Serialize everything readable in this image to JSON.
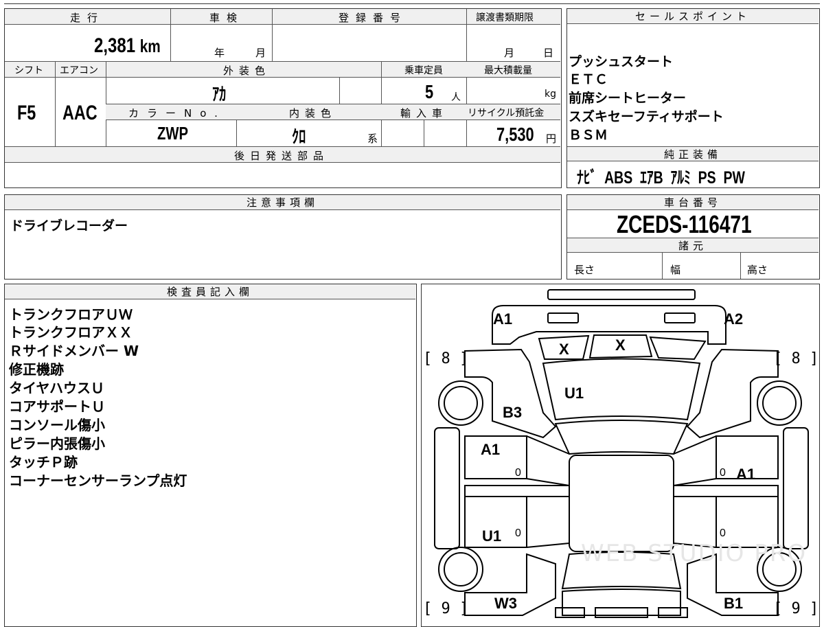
{
  "vehicle": {
    "headers": {
      "mileage": "走行",
      "inspection": "車検",
      "registration_no": "登録番号",
      "transfer_deadline": "譲渡書類期限",
      "shift": "シフト",
      "aircon": "エアコン",
      "exterior_color": "外装色",
      "capacity": "乗車定員",
      "max_load": "最大積載量",
      "color_no": "カラーNo.",
      "interior_color": "内装色",
      "import": "輸入車",
      "recycle_fee": "リサイクル預託金",
      "later_parts": "後日発送部品"
    },
    "mileage_value": "2,381",
    "mileage_unit": "km",
    "inspection_year_unit": "年",
    "inspection_month_unit": "月",
    "deadline_month_unit": "月",
    "deadline_day_unit": "日",
    "shift_value": "F5",
    "aircon_value": "AAC",
    "exterior_color_value": "ｱｶ",
    "capacity_value": "5",
    "capacity_unit": "人",
    "max_load_unit": "kg",
    "color_no_value": "ZWP",
    "interior_color_value": "ｸﾛ",
    "interior_color_unit": "系",
    "recycle_fee_value": "7,530",
    "recycle_fee_unit": "円"
  },
  "sales_points": {
    "header": "セールスポイント",
    "items": [
      "プッシュスタート",
      "ＥＴＣ",
      "前席シートヒーター",
      "スズキセーフティサポート",
      "ＢＳＭ"
    ]
  },
  "genuine_equipment": {
    "header": "純正装備",
    "value": "ﾅﾋﾞ  ABS  ｴｱB  ｱﾙﾐ  PS  PW"
  },
  "notes": {
    "header": "注意事項欄",
    "value": "ドライブレコーダー"
  },
  "chassis": {
    "header": "車台番号",
    "value": "ZCEDS-116471",
    "specs_header": "諸元",
    "length_label": "長さ",
    "width_label": "幅",
    "height_label": "高さ"
  },
  "inspector": {
    "header": "検査員記入欄",
    "lines": [
      "トランクフロアＵＷ",
      "トランクフロアＸＸ",
      "Ｒサイドメンバー W",
      "修正機跡",
      "タイヤハウスＵ",
      "コアサポートＵ",
      "コンソール傷小",
      "ピラー内張傷小",
      "タッチＰ跡",
      "コーナーセンサーランプ点灯"
    ]
  },
  "diagram": {
    "marks": {
      "a1_top_left": "A1",
      "a2_top_right": "A2",
      "x_left": "X",
      "x_center": "X",
      "u1_hood": "U1",
      "b3": "B3",
      "a1_left_door": "A1",
      "a1_right_door": "A1",
      "u1_left_rear_door": "U1",
      "w3": "W3",
      "b1": "B1"
    },
    "brackets": {
      "top_left": "[ 8 ]",
      "top_right": "[ 8 ]",
      "bottom_left": "[ 9 ]",
      "bottom_right": "[ 9 ]"
    },
    "zeros": [
      "0",
      "0",
      "0",
      "0"
    ],
    "watermark": "WEB STUDIO PRO"
  }
}
